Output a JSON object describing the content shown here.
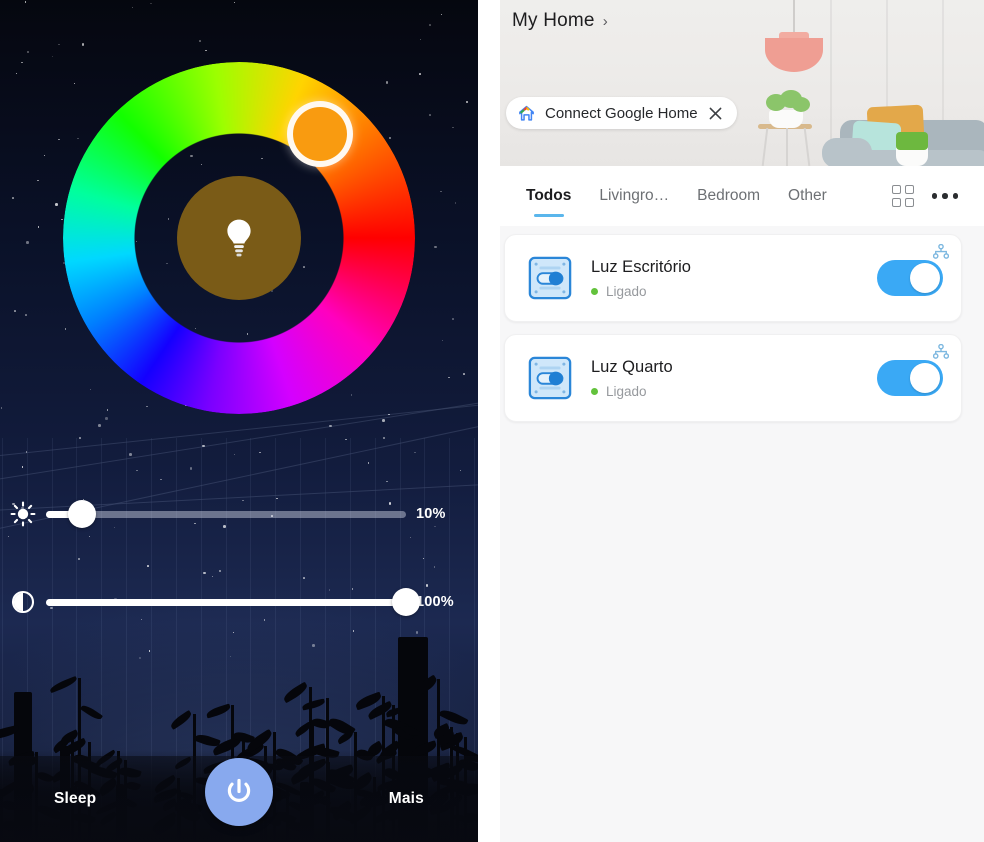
{
  "light_control": {
    "color_wheel": {
      "selected_color": "#f99b10",
      "inner_disc_color": "#7a5b17",
      "bulb_icon": "light-bulb-icon",
      "handle_angle_deg": 52
    },
    "sliders": [
      {
        "name": "brightness",
        "icon": "brightness-sun-icon",
        "value_label": "10%",
        "value": 10
      },
      {
        "name": "color-temperature",
        "icon": "contrast-half-circle-icon",
        "value_label": "100%",
        "value": 100
      }
    ],
    "bottom_bar": {
      "left_label": "Sleep",
      "right_label": "Mais",
      "power_icon": "power-icon",
      "power_color": "#88a9ee"
    }
  },
  "home_app": {
    "header": {
      "title": "My Home",
      "chevron": "›",
      "google_chip": {
        "icon": "google-home-icon",
        "label": "Connect Google Home",
        "close_icon": "close-icon"
      }
    },
    "tabs": [
      {
        "label": "Todos",
        "active": true
      },
      {
        "label": "Livingro…",
        "active": false
      },
      {
        "label": "Bedroom",
        "active": false
      },
      {
        "label": "Other",
        "active": false
      }
    ],
    "tab_actions": [
      {
        "icon": "grid-view-icon"
      },
      {
        "icon": "more-options-icon"
      }
    ],
    "devices": [
      {
        "name": "Luz Escritório",
        "status": "Ligado",
        "toggle_on": true,
        "icon": "smart-switch-icon",
        "badge_icon": "network-topology-icon"
      },
      {
        "name": "Luz Quarto",
        "status": "Ligado",
        "toggle_on": true,
        "icon": "smart-switch-icon",
        "badge_icon": "network-topology-icon"
      }
    ],
    "colors": {
      "accent": "#3aa9f5",
      "tab_underline": "#5ab6ec",
      "status_dot": "#63c23c",
      "panel_bg": "#f7f7f8",
      "card_bg": "#ffffff"
    }
  }
}
